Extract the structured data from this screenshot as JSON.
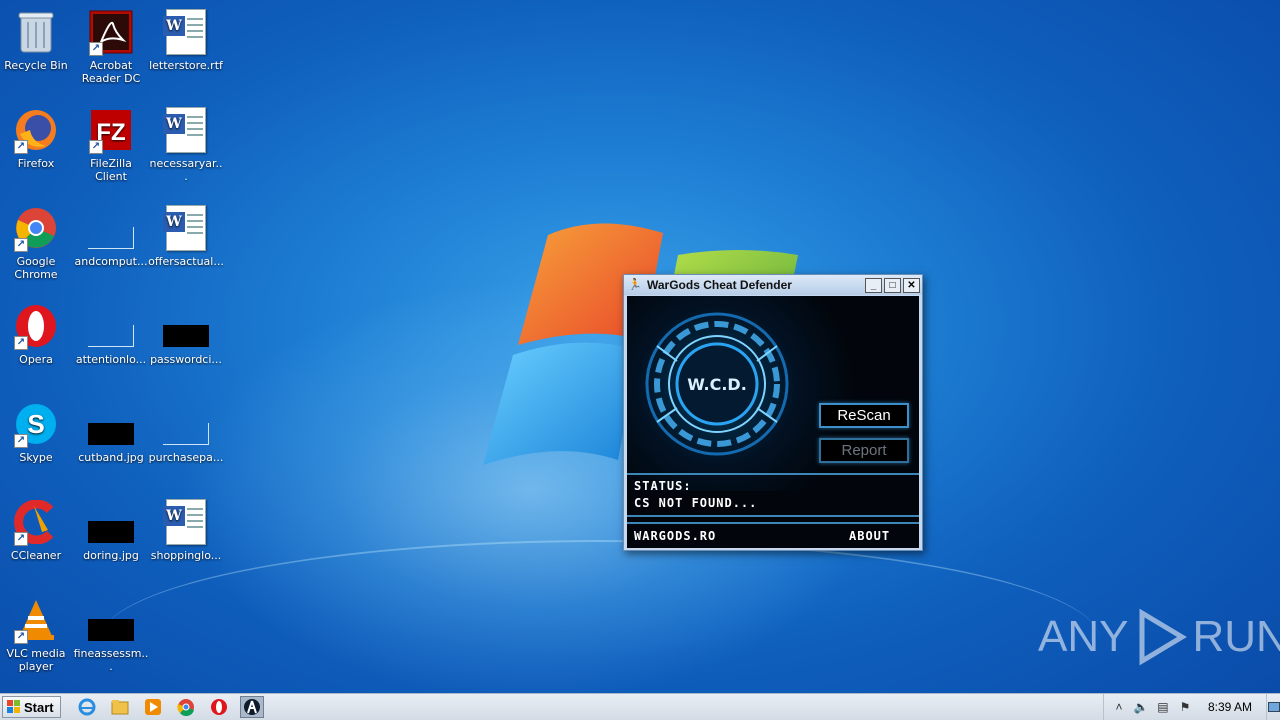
{
  "desktop": {
    "icons": [
      {
        "label": "Recycle Bin",
        "icon": "recycle-bin-icon"
      },
      {
        "label": "Acrobat Reader DC",
        "icon": "acrobat-icon"
      },
      {
        "label": "letterstore.rtf",
        "icon": "word-document-icon"
      },
      {
        "label": "Firefox",
        "icon": "firefox-icon"
      },
      {
        "label": "FileZilla Client",
        "icon": "filezilla-icon"
      },
      {
        "label": "necessaryar...",
        "icon": "word-document-icon"
      },
      {
        "label": "Google Chrome",
        "icon": "chrome-icon"
      },
      {
        "label": "andcomput...",
        "icon": "blank-file-icon"
      },
      {
        "label": "offersactual...",
        "icon": "word-document-icon"
      },
      {
        "label": "Opera",
        "icon": "opera-icon"
      },
      {
        "label": "attentionlo...",
        "icon": "blank-file-icon"
      },
      {
        "label": "passwordci...",
        "icon": "black-image-icon"
      },
      {
        "label": "Skype",
        "icon": "skype-icon"
      },
      {
        "label": "cutband.jpg",
        "icon": "black-image-icon"
      },
      {
        "label": "purchasepa...",
        "icon": "blank-file-icon"
      },
      {
        "label": "CCleaner",
        "icon": "ccleaner-icon"
      },
      {
        "label": "doring.jpg",
        "icon": "black-image-icon"
      },
      {
        "label": "shoppinglo...",
        "icon": "word-document-icon"
      },
      {
        "label": "VLC media player",
        "icon": "vlc-icon"
      },
      {
        "label": "fineassessm...",
        "icon": "black-image-icon"
      }
    ]
  },
  "app_window": {
    "title": "WarGods Cheat Defender",
    "controls": {
      "minimize": "_",
      "maximize": "□",
      "close": "✕"
    },
    "logo_text": "W.C.D.",
    "rescan_label": "ReScan",
    "report_label": "Report",
    "status_label": "STATUS:",
    "status_value": "CS NOT FOUND...",
    "site_link": "WARGODS.RO",
    "about_link": "ABOUT"
  },
  "watermark": {
    "left": "ANY",
    "right": "RUN"
  },
  "taskbar": {
    "start_label": "Start",
    "pinned": [
      "ie-icon",
      "explorer-icon",
      "media-player-icon",
      "chrome-icon",
      "opera-icon",
      "wcd-app-icon"
    ],
    "clock": "8:39 AM"
  },
  "colors": {
    "accent_blue": "#3d8fc9",
    "app_background": "#02060c",
    "desktop_blue": "#1e7fd4"
  }
}
